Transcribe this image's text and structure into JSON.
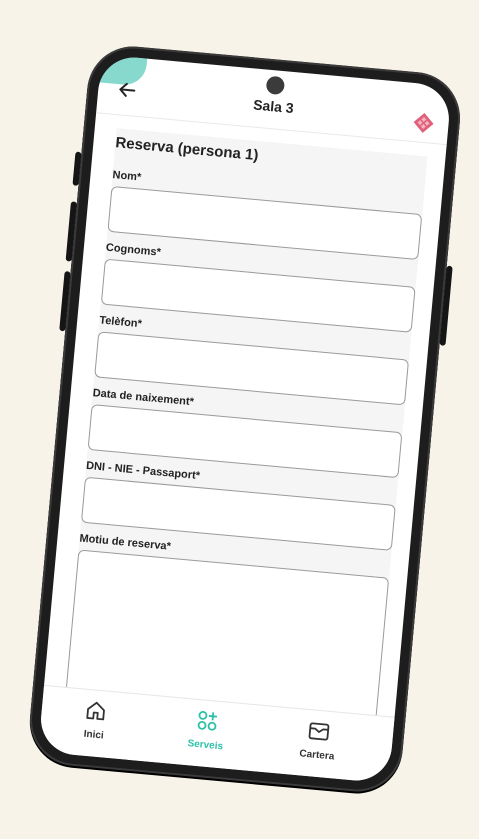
{
  "header": {
    "title": "Sala 3",
    "back_icon": "arrow-left-icon",
    "logo_icon": "diamond-logo-icon"
  },
  "form": {
    "heading": "Reserva (persona 1)",
    "fields": [
      {
        "label": "Nom*",
        "value": ""
      },
      {
        "label": "Cognoms*",
        "value": ""
      },
      {
        "label": "Telèfon*",
        "value": ""
      },
      {
        "label": "Data de naixement*",
        "value": ""
      },
      {
        "label": "DNI - NIE - Passaport*",
        "value": ""
      },
      {
        "label": "Motiu de reserva*",
        "value": ""
      }
    ]
  },
  "bottom_nav": {
    "items": [
      {
        "label": "Inici",
        "icon": "home-icon"
      },
      {
        "label": "Serveis",
        "icon": "services-grid-icon",
        "active": true
      },
      {
        "label": "Cartera",
        "icon": "wallet-icon"
      }
    ]
  },
  "colors": {
    "accent": "#2cc1a6",
    "background": "#f8f3e8",
    "phone_frame": "#1d1d1d",
    "logo": "#e0607a"
  }
}
